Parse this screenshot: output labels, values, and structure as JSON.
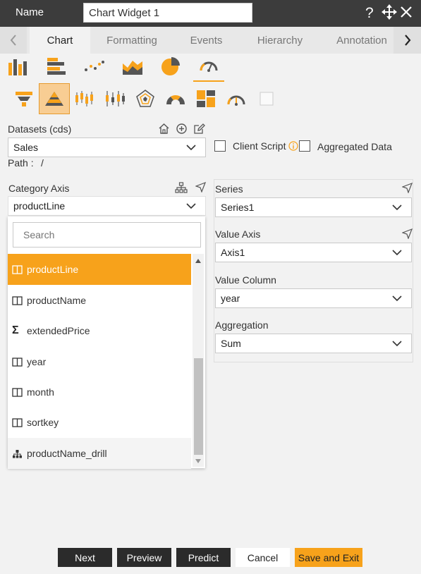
{
  "header": {
    "name_label": "Name",
    "widget_name": "Chart Widget 1",
    "help_icon": "question-mark-icon",
    "move_icon": "move-arrows-icon",
    "close_icon": "close-icon"
  },
  "tabs": {
    "items": [
      "Chart",
      "Formatting",
      "Events",
      "Hierarchy",
      "Annotation"
    ],
    "active": "Chart"
  },
  "chart_types": {
    "row1": [
      "column-chart-icon",
      "bar-chart-icon",
      "scatter-chart-icon",
      "area-chart-icon",
      "pie-chart-icon",
      "gauge-chart-icon"
    ],
    "row2": [
      "funnel-chart-icon",
      "pyramid-chart-icon",
      "candlestick-chart-icon",
      "boxplot-chart-icon",
      "radar-chart-icon",
      "semi-donut-chart-icon",
      "treemap-chart-icon",
      "meter-gauge-icon",
      "blank-chart-icon"
    ],
    "selected": "pyramid-chart-icon"
  },
  "datasets": {
    "label": "Datasets (cds)",
    "value": "Sales",
    "path_label": "Path :",
    "path_value": "/"
  },
  "options": {
    "client_script": "Client Script",
    "aggregated_data": "Aggregated Data"
  },
  "category_axis": {
    "label": "Category Axis",
    "value": "productLine",
    "search_placeholder": "Search",
    "items": [
      {
        "label": "productLine",
        "icon": "column-field-icon"
      },
      {
        "label": "productName",
        "icon": "column-field-icon"
      },
      {
        "label": "extendedPrice",
        "icon": "sigma-measure-icon"
      },
      {
        "label": "year",
        "icon": "column-field-icon"
      },
      {
        "label": "month",
        "icon": "column-field-icon"
      },
      {
        "label": "sortkey",
        "icon": "column-field-icon"
      },
      {
        "label": "productName_drill",
        "icon": "hierarchy-icon"
      }
    ]
  },
  "series": {
    "label": "Series",
    "value": "Series1"
  },
  "value_axis": {
    "label": "Value Axis",
    "value": "Axis1"
  },
  "value_column": {
    "label": "Value Column",
    "value": "year"
  },
  "aggregation": {
    "label": "Aggregation",
    "value": "Sum"
  },
  "colors": {
    "accent": "#f7a21b",
    "header": "#3c3c3c",
    "dark_button": "#2b2b2b"
  },
  "buttons": {
    "next": "Next",
    "preview": "Preview",
    "predict": "Predict",
    "cancel": "Cancel",
    "save_exit": "Save and Exit"
  }
}
